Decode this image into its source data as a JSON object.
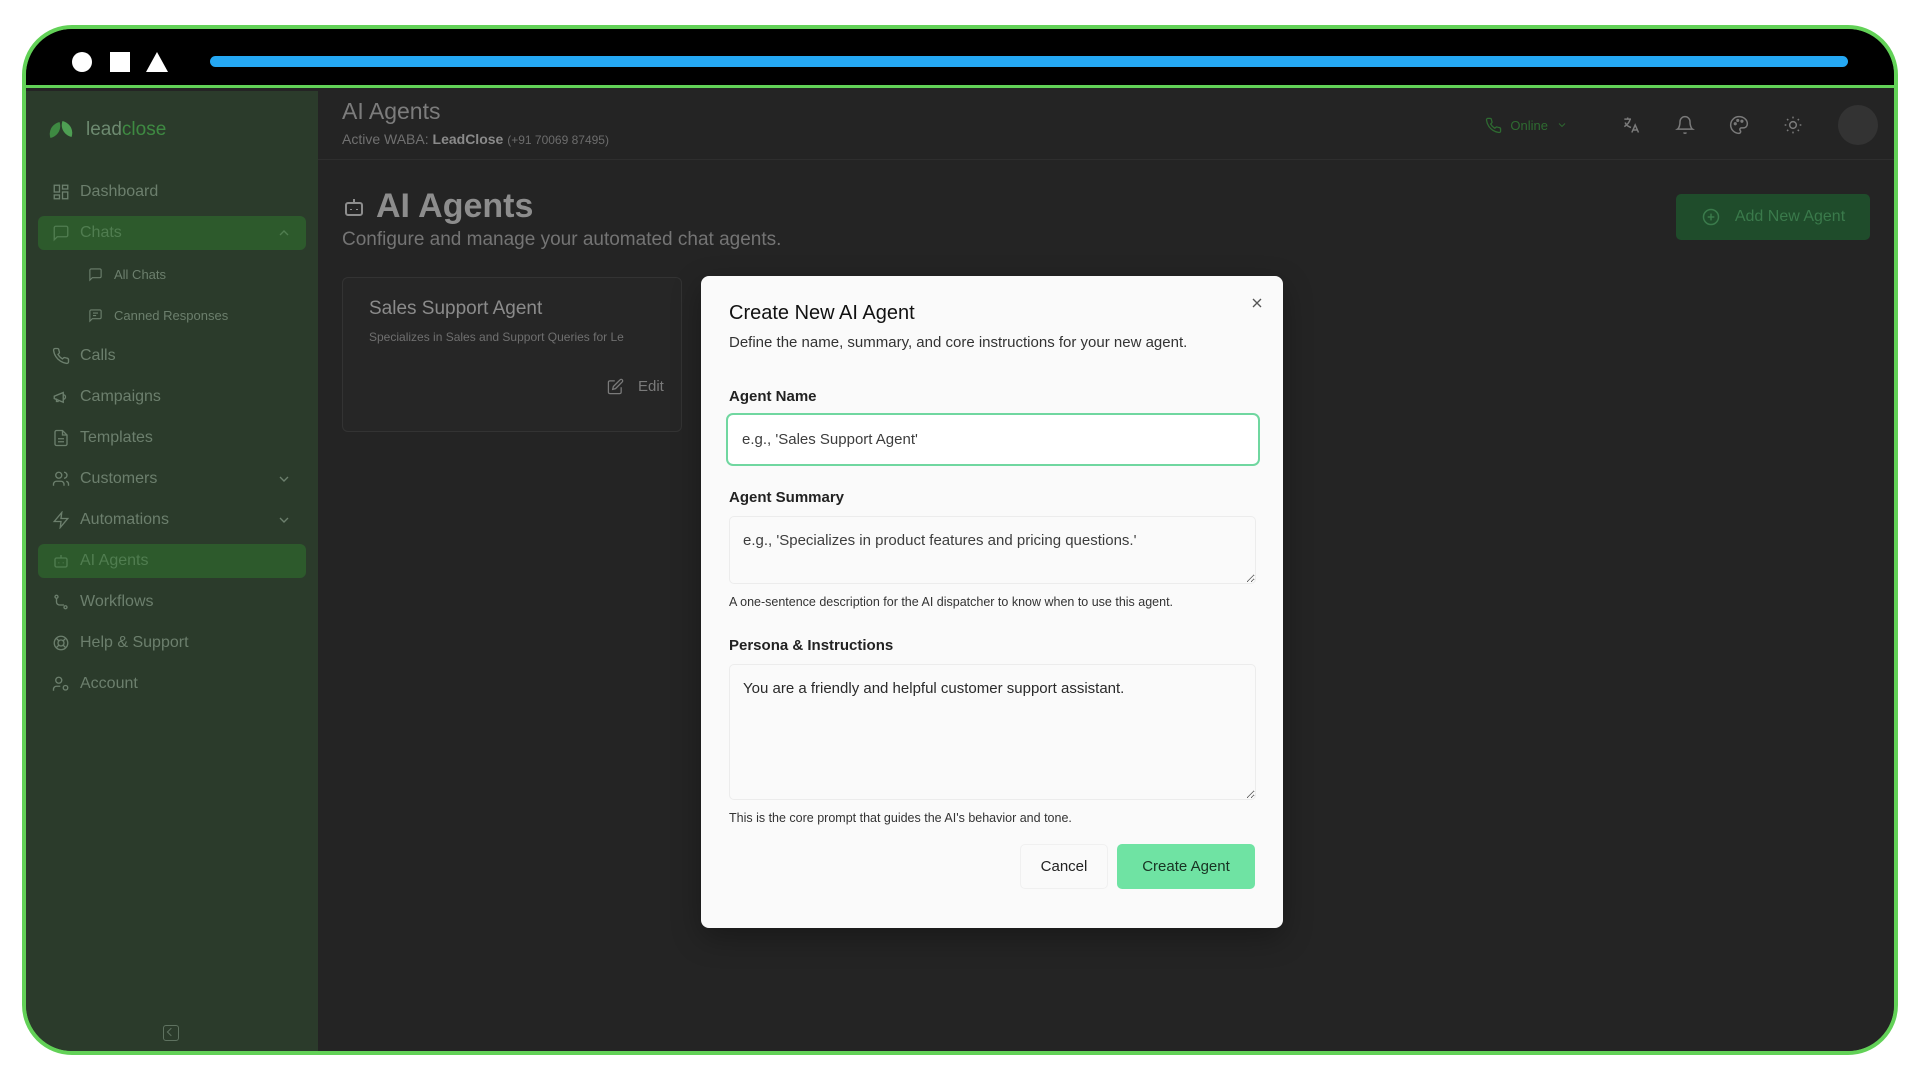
{
  "sidebar": {
    "logo_part1": "lead",
    "logo_part2": "close",
    "items": [
      {
        "label": "Dashboard"
      },
      {
        "label": "Chats"
      },
      {
        "label": "All Chats"
      },
      {
        "label": "Canned Responses"
      },
      {
        "label": "Calls"
      },
      {
        "label": "Campaigns"
      },
      {
        "label": "Templates"
      },
      {
        "label": "Customers"
      },
      {
        "label": "Automations"
      },
      {
        "label": "AI Agents"
      },
      {
        "label": "Workflows"
      },
      {
        "label": "Help & Support"
      },
      {
        "label": "Account"
      }
    ]
  },
  "header": {
    "title": "AI Agents",
    "waba_prefix": "Active WABA: ",
    "waba_name": "LeadClose",
    "waba_phone": "(+91 70069 87495)",
    "status": "Online"
  },
  "page": {
    "title": "AI Agents",
    "description": "Configure and manage your automated chat agents.",
    "add_button": "Add New Agent"
  },
  "card": {
    "title": "Sales Support Agent",
    "description": "Specializes in Sales and Support Queries for Le",
    "edit_label": "Edit"
  },
  "modal": {
    "title": "Create New AI Agent",
    "description": "Define the name, summary, and core instructions for your new agent.",
    "name_label": "Agent Name",
    "name_placeholder": "e.g., 'Sales Support Agent'",
    "summary_label": "Agent Summary",
    "summary_placeholder": "e.g., 'Specializes in product features and pricing questions.'",
    "summary_hint": "A one-sentence description for the AI dispatcher to know when to use this agent.",
    "persona_label": "Persona & Instructions",
    "persona_value": "You are a friendly and helpful customer support assistant.",
    "persona_hint": "This is the core prompt that guides the AI's behavior and tone.",
    "cancel_label": "Cancel",
    "create_label": "Create Agent"
  },
  "colors": {
    "frame_border": "#62d157",
    "progress": "#25a8f4",
    "accent": "#6fe3a3"
  }
}
